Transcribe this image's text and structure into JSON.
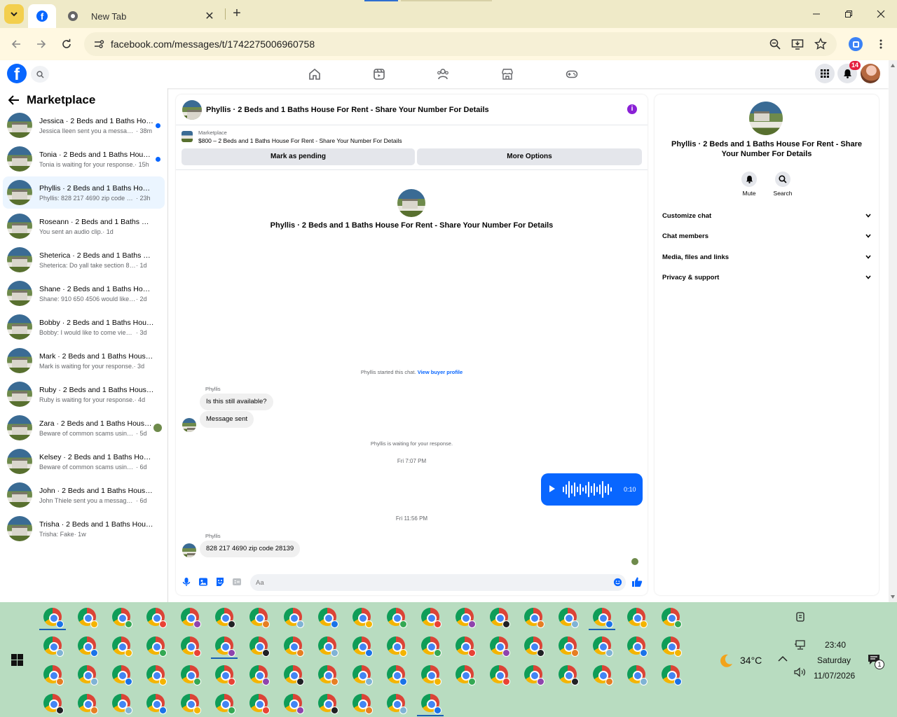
{
  "browser": {
    "tab_title": "New Tab",
    "url": "facebook.com/messages/t/1742275006960758"
  },
  "fb": {
    "notification_count": "14"
  },
  "left": {
    "title": "Marketplace",
    "conversations": [
      {
        "name": "Jessica · 2 Beds and 1 Baths Hous...",
        "preview": "Jessica Ileen sent you a message ...",
        "time": "· 38m",
        "unread": true
      },
      {
        "name": "Tonia · 2 Beds and 1 Baths House...",
        "preview": "Tonia is waiting for your response.",
        "time": "· 15h",
        "unread": true
      },
      {
        "name": "Phyllis · 2 Beds and 1 Baths House ...",
        "preview": "Phyllis: 828 217 4690 zip code 28139",
        "time": "· 23h",
        "selected": true
      },
      {
        "name": "Roseann · 2 Beds and 1 Baths Hous...",
        "preview": "You sent an audio clip.",
        "time": "· 1d"
      },
      {
        "name": "Sheterica · 2 Beds and 1 Baths Hou...",
        "preview": "Sheterica: Do yall take section 8 vouc...",
        "time": "· 1d"
      },
      {
        "name": "Shane · 2 Beds and 1 Baths House ...",
        "preview": "Shane: 910 650 4506 would like to dis...",
        "time": "· 2d"
      },
      {
        "name": "Bobby · 2 Beds and 1 Baths House ...",
        "preview": "Bobby: I would like to come view the ...",
        "time": "· 3d"
      },
      {
        "name": "Mark · 2 Beds and 1 Baths House F...",
        "preview": "Mark is waiting for your response.",
        "time": "· 3d"
      },
      {
        "name": "Ruby · 2 Beds and 1 Baths House F...",
        "preview": "Ruby is waiting for your response.",
        "time": "· 4d"
      },
      {
        "name": "Zara · 2 Beds and 1 Baths House ...",
        "preview": "Beware of common scams using p...",
        "time": "· 5d",
        "seen_avatar": true
      },
      {
        "name": "Kelsey · 2 Beds and 1 Baths House ...",
        "preview": "Beware of common scams using pay...",
        "time": "· 6d"
      },
      {
        "name": "John · 2 Beds and 1 Baths House F...",
        "preview": "John Thiele sent you a message about...",
        "time": "· 6d"
      },
      {
        "name": "Trisha · 2 Beds and 1 Baths House ...",
        "preview": "Trisha: Fake",
        "time": "· 1w"
      }
    ]
  },
  "chat": {
    "title": "Phyllis · 2 Beds and 1 Baths House For Rent - Share Your Number For Details",
    "listing_label": "Marketplace",
    "listing_desc": "$800 – 2 Beds and 1 Baths House For Rent - Share Your Number For Details",
    "mark_pending": "Mark as pending",
    "more_options": "More Options",
    "started": "Phyllis started this chat.",
    "view_profile": "View buyer profile",
    "sender1": "Phyllis",
    "msg1": "Is this still available?",
    "msg2": "Message sent",
    "waiting": "Phyllis is waiting for your response.",
    "time1": "Fri 7:07 PM",
    "audio_duration": "0:10",
    "time2": "Fri 11:56 PM",
    "sender2": "Phyllis",
    "msg3": "828 217 4690 zip code 28139",
    "composer_placeholder": "Aa"
  },
  "right": {
    "name": "Phyllis · 2 Beds and 1 Baths House For Rent - Share Your Number For Details",
    "mute": "Mute",
    "search": "Search",
    "sections": [
      "Customize chat",
      "Chat members",
      "Media, files and links",
      "Privacy & support"
    ]
  },
  "tray": {
    "temperature": "34°C",
    "time": "23:40",
    "day": "Saturday",
    "date": "11/07/2026",
    "notif_count": "1"
  }
}
